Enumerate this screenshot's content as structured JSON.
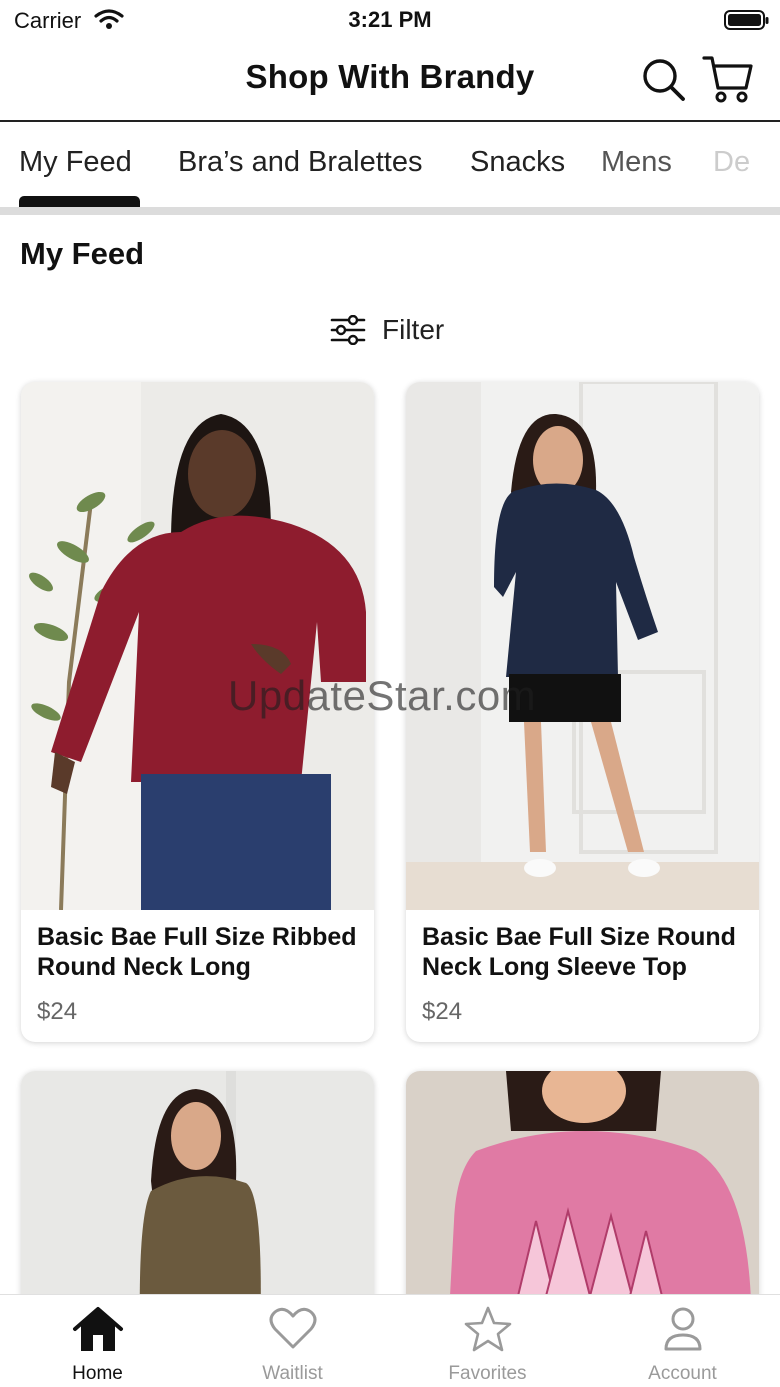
{
  "status_bar": {
    "carrier": "Carrier",
    "time": "3:21 PM"
  },
  "header": {
    "title": "Shop With Brandy",
    "search_icon": "search-icon",
    "cart_icon": "cart-icon"
  },
  "tabs": [
    {
      "label": "My Feed",
      "active": true
    },
    {
      "label": "Bra’s and Bralettes"
    },
    {
      "label": "Snacks"
    },
    {
      "label": "Mens"
    },
    {
      "label": "De"
    }
  ],
  "section_title": "My Feed",
  "filter": {
    "label": "Filter",
    "icon": "sliders-icon"
  },
  "products": [
    {
      "name": "Basic Bae Full Size Ribbed Round Neck Long",
      "price": "$24",
      "garment_color": "#8e1c2e"
    },
    {
      "name": "Basic Bae Full Size Round Neck Long Sleeve Top",
      "price": "$24",
      "garment_color": "#1f2a44"
    },
    {
      "name": "",
      "price": "",
      "garment_color": "#6b5a3e"
    },
    {
      "name": "",
      "price": "",
      "garment_color": "#e07aa4"
    }
  ],
  "watermark": "UpdateStar.com",
  "bottom_nav": [
    {
      "label": "Home",
      "icon": "home-icon",
      "active": true
    },
    {
      "label": "Waitlist",
      "icon": "heart-icon"
    },
    {
      "label": "Favorites",
      "icon": "star-icon"
    },
    {
      "label": "Account",
      "icon": "user-icon"
    }
  ]
}
